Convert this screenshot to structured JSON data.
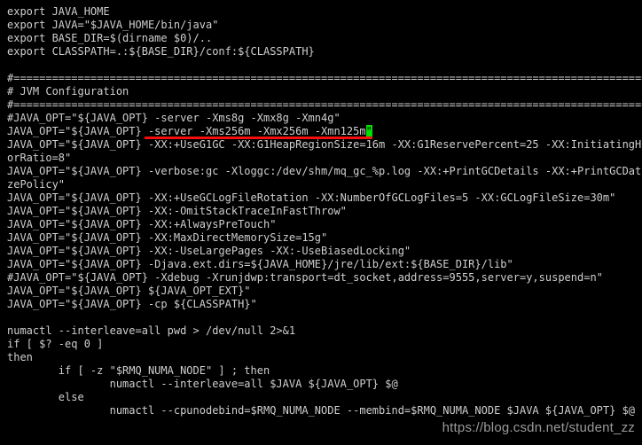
{
  "terminal": {
    "background_color": "#000000",
    "foreground_color": "#cfcfcf",
    "cursor_color": "#00e000",
    "annotation_color": "#f40f0f",
    "watermark_color": "#9a9a9a",
    "lines": [
      "export JAVA_HOME",
      "export JAVA=\"$JAVA_HOME/bin/java\"",
      "export BASE_DIR=$(dirname $0)/..",
      "export CLASSPATH=.:${BASE_DIR}/conf:${CLASSPATH}",
      "",
      "#===================================================================================================",
      "# JVM Configuration",
      "#===================================================================================================",
      "#JAVA_OPT=\"${JAVA_OPT} -server -Xms8g -Xmx8g -Xmn4g\"",
      "JAVA_OPT=\"${JAVA_OPT} -server -Xms256m -Xmx256m -Xmn125m",
      "JAVA_OPT=\"${JAVA_OPT} -XX:+UseG1GC -XX:G1HeapRegionSize=16m -XX:G1ReservePercent=25 -XX:InitiatingHeapOccupancy",
      "orRatio=8\"",
      "JAVA_OPT=\"${JAVA_OPT} -verbose:gc -Xloggc:/dev/shm/mq_gc_%p.log -XX:+PrintGCDetails -XX:+PrintGCDateStamps -XX:+PrintGCApplicationStoppedTime -XX:+PrintAdaptiveSi",
      "zePolicy\"",
      "JAVA_OPT=\"${JAVA_OPT} -XX:+UseGCLogFileRotation -XX:NumberOfGCLogFiles=5 -XX:GCLogFileSize=30m\"",
      "JAVA_OPT=\"${JAVA_OPT} -XX:-OmitStackTraceInFastThrow\"",
      "JAVA_OPT=\"${JAVA_OPT} -XX:+AlwaysPreTouch\"",
      "JAVA_OPT=\"${JAVA_OPT} -XX:MaxDirectMemorySize=15g\"",
      "JAVA_OPT=\"${JAVA_OPT} -XX:-UseLargePages -XX:-UseBiasedLocking\"",
      "JAVA_OPT=\"${JAVA_OPT} -Djava.ext.dirs=${JAVA_HOME}/jre/lib/ext:${BASE_DIR}/lib\"",
      "#JAVA_OPT=\"${JAVA_OPT} -Xdebug -Xrunjdwp:transport=dt_socket,address=9555,server=y,suspend=n\"",
      "JAVA_OPT=\"${JAVA_OPT} ${JAVA_OPT_EXT}\"",
      "JAVA_OPT=\"${JAVA_OPT} -cp ${CLASSPATH}\"",
      "",
      "numactl --interleave=all pwd > /dev/null 2>&1",
      "if [ $? -eq 0 ]",
      "then",
      "        if [ -z \"$RMQ_NUMA_NODE\" ] ; then",
      "                numactl --interleave=all $JAVA ${JAVA_OPT} $@",
      "        else",
      "                numactl --cpunodebind=$RMQ_NUMA_NODE --membind=$RMQ_NUMA_NODE $JAVA ${JAVA_OPT} $@"
    ],
    "cursor": {
      "line_index": 9,
      "glyph": "\""
    }
  },
  "watermark": {
    "text": "https://blog.csdn.net/student_zz"
  }
}
